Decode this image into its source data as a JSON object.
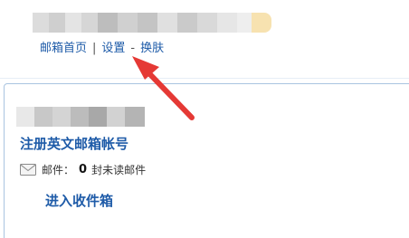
{
  "topnav": {
    "home_label": "邮箱首页",
    "separator": "|",
    "settings_label": "设置",
    "dash": "-",
    "skin_label": "换肤"
  },
  "account": {
    "title": "注册英文邮箱帐号"
  },
  "mail_status": {
    "prefix": "邮件：",
    "unread_count": "0",
    "suffix": "封未读邮件"
  },
  "inbox": {
    "label": "进入收件箱"
  },
  "icons": {
    "envelope": "envelope-icon",
    "annotation": "red-arrow-annotation"
  },
  "colors": {
    "link": "#1e5ba8",
    "panel_border": "#a9c4e0",
    "arrow": "#e53935"
  }
}
